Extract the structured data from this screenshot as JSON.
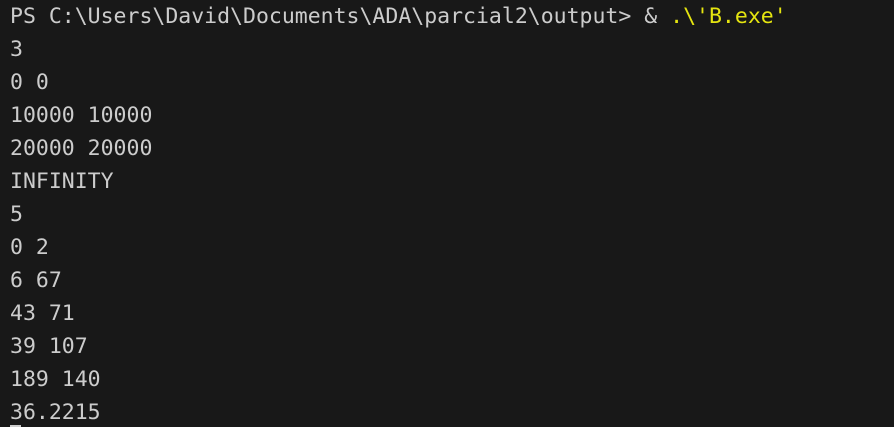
{
  "terminal": {
    "prompt": "PS C:\\Users\\David\\Documents\\ADA\\parcial2\\output> ",
    "command_op": "& ",
    "command_path": ".\\'B.exe'",
    "output": [
      "3",
      "0 0",
      "10000 10000",
      "20000 20000",
      "INFINITY",
      "5",
      "0 2",
      "6 67",
      "43 71",
      "39 107",
      "189 140",
      "36.2215"
    ]
  },
  "colors": {
    "background": "#181818",
    "text": "#cccccc",
    "command_highlight": "#e5e510"
  }
}
